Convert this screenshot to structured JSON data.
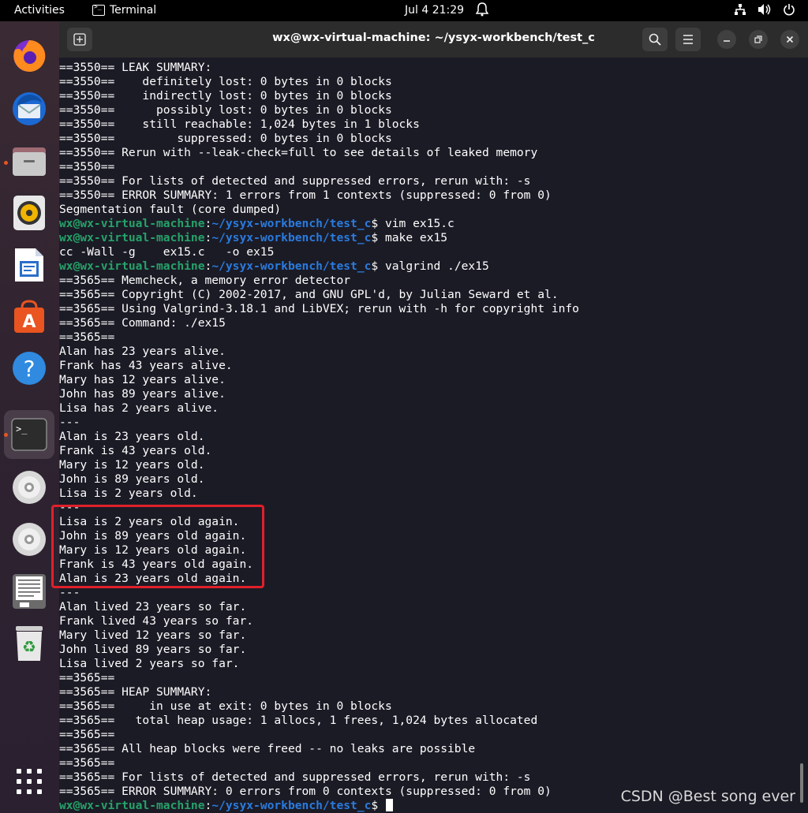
{
  "topbar": {
    "activities": "Activities",
    "app_name": "Terminal",
    "clock": "Jul 4  21:29",
    "icons": [
      "network-icon",
      "volume-icon",
      "power-icon"
    ]
  },
  "dock": {
    "items": [
      "firefox-icon",
      "thunderbird-icon",
      "files-icon",
      "rhythmbox-icon",
      "libreoffice-writer-icon",
      "app-center-icon",
      "help-icon",
      "terminal-icon",
      "dvd-drive-icon",
      "dvd-drive-icon",
      "text-editor-icon",
      "trash-icon",
      "show-apps-icon"
    ],
    "accent": "#e95420"
  },
  "window": {
    "title": "wx@wx-virtual-machine: ~/ysyx-workbench/test_c"
  },
  "terminal": {
    "prompt_user": "wx@wx-virtual-machine",
    "prompt_sep": ":",
    "prompt_path": "~/ysyx-workbench/test_c",
    "prompt_end": "$ ",
    "lines": [
      {
        "text": "==3550== LEAK SUMMARY:"
      },
      {
        "text": "==3550==    definitely lost: 0 bytes in 0 blocks"
      },
      {
        "text": "==3550==    indirectly lost: 0 bytes in 0 blocks"
      },
      {
        "text": "==3550==      possibly lost: 0 bytes in 0 blocks"
      },
      {
        "text": "==3550==    still reachable: 1,024 bytes in 1 blocks"
      },
      {
        "text": "==3550==         suppressed: 0 bytes in 0 blocks"
      },
      {
        "text": "==3550== Rerun with --leak-check=full to see details of leaked memory"
      },
      {
        "text": "==3550=="
      },
      {
        "text": "==3550== For lists of detected and suppressed errors, rerun with: -s"
      },
      {
        "text": "==3550== ERROR SUMMARY: 1 errors from 1 contexts (suppressed: 0 from 0)"
      },
      {
        "text": "Segmentation fault (core dumped)"
      },
      {
        "prompt": true,
        "text": "vim ex15.c"
      },
      {
        "prompt": true,
        "text": "make ex15"
      },
      {
        "text": "cc -Wall -g    ex15.c   -o ex15"
      },
      {
        "prompt": true,
        "text": "valgrind ./ex15"
      },
      {
        "text": "==3565== Memcheck, a memory error detector"
      },
      {
        "text": "==3565== Copyright (C) 2002-2017, and GNU GPL'd, by Julian Seward et al."
      },
      {
        "text": "==3565== Using Valgrind-3.18.1 and LibVEX; rerun with -h for copyright info"
      },
      {
        "text": "==3565== Command: ./ex15"
      },
      {
        "text": "==3565=="
      },
      {
        "text": "Alan has 23 years alive."
      },
      {
        "text": "Frank has 43 years alive."
      },
      {
        "text": "Mary has 12 years alive."
      },
      {
        "text": "John has 89 years alive."
      },
      {
        "text": "Lisa has 2 years alive."
      },
      {
        "text": "---"
      },
      {
        "text": "Alan is 23 years old."
      },
      {
        "text": "Frank is 43 years old."
      },
      {
        "text": "Mary is 12 years old."
      },
      {
        "text": "John is 89 years old."
      },
      {
        "text": "Lisa is 2 years old."
      },
      {
        "text": "---"
      },
      {
        "text": "Lisa is 2 years old again."
      },
      {
        "text": "John is 89 years old again."
      },
      {
        "text": "Mary is 12 years old again."
      },
      {
        "text": "Frank is 43 years old again."
      },
      {
        "text": "Alan is 23 years old again."
      },
      {
        "text": "---"
      },
      {
        "text": "Alan lived 23 years so far."
      },
      {
        "text": "Frank lived 43 years so far."
      },
      {
        "text": "Mary lived 12 years so far."
      },
      {
        "text": "John lived 89 years so far."
      },
      {
        "text": "Lisa lived 2 years so far."
      },
      {
        "text": "==3565=="
      },
      {
        "text": "==3565== HEAP SUMMARY:"
      },
      {
        "text": "==3565==     in use at exit: 0 bytes in 0 blocks"
      },
      {
        "text": "==3565==   total heap usage: 1 allocs, 1 frees, 1,024 bytes allocated"
      },
      {
        "text": "==3565=="
      },
      {
        "text": "==3565== All heap blocks were freed -- no leaks are possible"
      },
      {
        "text": "==3565=="
      },
      {
        "text": "==3565== For lists of detected and suppressed errors, rerun with: -s"
      },
      {
        "text": "==3565== ERROR SUMMARY: 0 errors from 0 contexts (suppressed: 0 from 0)"
      },
      {
        "prompt": true,
        "text": "",
        "cursor": true
      }
    ]
  },
  "highlight_color": "#e0202a",
  "watermark": "CSDN @Best song ever"
}
